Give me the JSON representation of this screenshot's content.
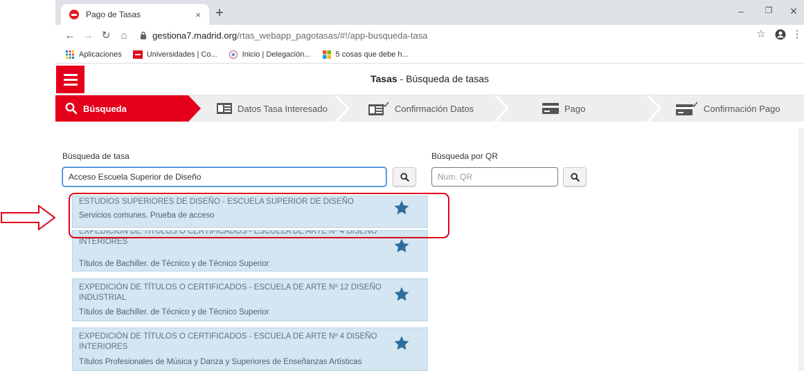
{
  "browser": {
    "tab_title": "Pago de Tasas",
    "tab_close": "×",
    "new_tab": "+",
    "url_host": "gestiona7.madrid.org",
    "url_path": "/rtas_webapp_pagotasas/#!/app-busqueda-tasa",
    "bookmarks": [
      {
        "label": "Aplicaciones",
        "icon": "apps-grid-icon"
      },
      {
        "label": "Universidades | Co...",
        "icon": "madrid-logo-icon"
      },
      {
        "label": "Inicio | Delegación...",
        "icon": "delegacion-icon"
      },
      {
        "label": "5 cosas que debe h...",
        "icon": "windows-logo-icon"
      }
    ],
    "colors": {
      "tabstrip": "#dee1e6"
    }
  },
  "header": {
    "title_bold": "Tasas",
    "title_rest": " - Búsqueda de tasas",
    "colors": {
      "accent": "#e4001b"
    }
  },
  "steps": [
    {
      "label": "Búsqueda",
      "icon": "search-icon",
      "active": true
    },
    {
      "label": "Datos Tasa Interesado",
      "icon": "id-card-icon",
      "active": false
    },
    {
      "label": "Confirmación Datos",
      "icon": "id-card-check-icon",
      "active": false
    },
    {
      "label": "Pago",
      "icon": "credit-card-icon",
      "active": false
    },
    {
      "label": "Confirmación Pago",
      "icon": "credit-card-check-icon",
      "active": false
    }
  ],
  "search": {
    "label": "Búsqueda de tasa",
    "value": "Acceso Escuela Superior de Diseño"
  },
  "qr": {
    "label": "Búsqueda por QR",
    "placeholder": "Num. QR"
  },
  "results": [
    {
      "title": "ESTUDIOS SUPERIORES DE DISEÑO - ESCUELA SUPERIOR DE DISEÑO",
      "subtitle": "Servicios comunes. Prueba de acceso",
      "icon": "star-icon"
    },
    {
      "title": "EXPEDICIÓN DE TÍTULOS O CERTIFICADOS - ESCUELA DE ARTE Nº 4 DISEÑO INTERIORES",
      "subtitle": "Títulos de Bachiller. de Técnico y de Técnico Superior",
      "icon": "star-icon"
    },
    {
      "title": "EXPEDICIÓN DE TÍTULOS O CERTIFICADOS - ESCUELA DE ARTE Nº 12 DISEÑO INDUSTRIAL",
      "subtitle": "Títulos de Bachiller. de Técnico y de Técnico Superior",
      "icon": "star-icon"
    },
    {
      "title": "EXPEDICIÓN DE TÍTULOS O CERTIFICADOS - ESCUELA DE ARTE Nº 4 DISEÑO INTERIORES",
      "subtitle": "Títulos Profesionales de Música y Danza y Superiores de Enseñanzas Artísticas",
      "icon": "star-icon"
    }
  ],
  "annotation": {
    "arrow": "arrow-right-outline",
    "highlight_color": "#e0001a"
  }
}
